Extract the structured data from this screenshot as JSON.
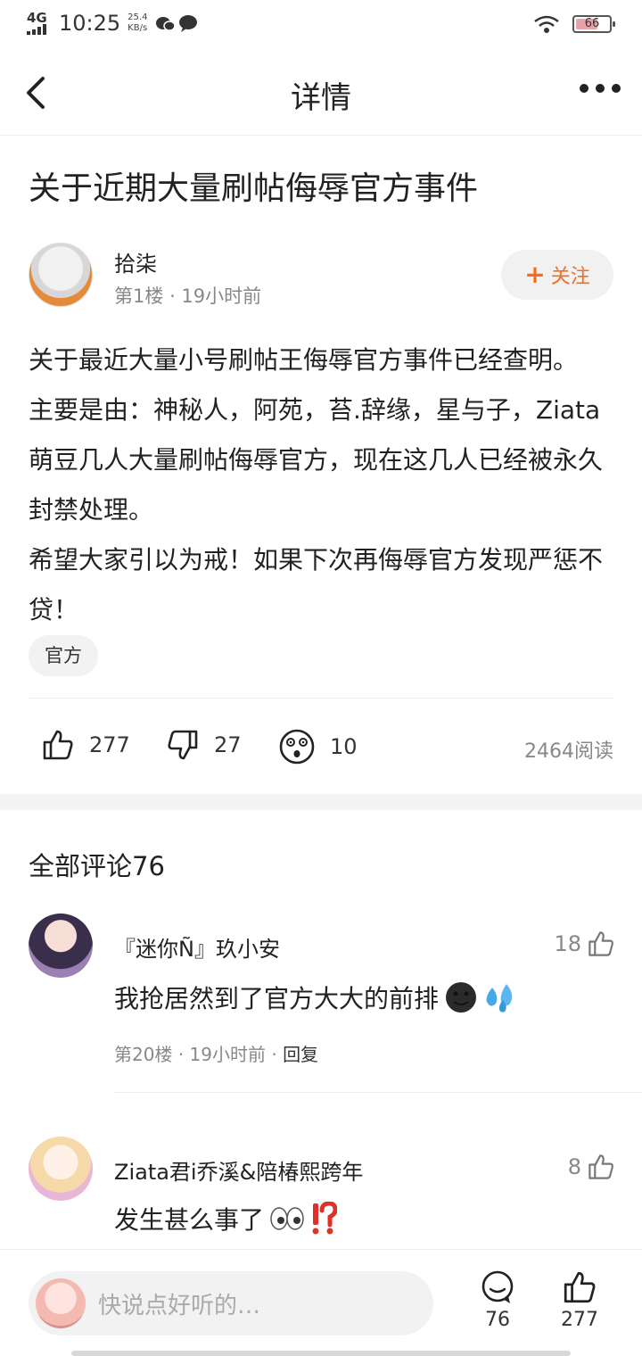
{
  "status_bar": {
    "network": "4G",
    "time": "10:25",
    "speed_value": "25.4",
    "speed_unit": "KB/s",
    "battery": "66"
  },
  "nav": {
    "title": "详情"
  },
  "post": {
    "title": "关于近期大量刷帖侮辱官方事件",
    "author": "拾柒",
    "floor": "第1楼",
    "time": "19小时前",
    "follow_label": "关注",
    "body": [
      "关于最近大量小号刷帖王侮辱官方事件已经查明。",
      "主要是由：神秘人，阿苑，苔.辞缘，星与子，Ziata萌豆几人大量刷帖侮辱官方，现在这几人已经被永久封禁处理。",
      "希望大家引以为戒！如果下次再侮辱官方发现严惩不贷！"
    ],
    "tag": "官方",
    "likes": "277",
    "dislikes": "27",
    "reactions": "10",
    "reads": "2464阅读"
  },
  "comments": {
    "header": "全部评论76",
    "items": [
      {
        "name": "『迷你Ñ』玖小安",
        "likes": "18",
        "text": "我抢居然到了官方大大的前排",
        "floor": "第20楼",
        "time": "19小时前",
        "reply": "回复"
      },
      {
        "name": "Ziata君i乔溪&陪椿熙跨年",
        "likes": "8",
        "text": "发生甚么事了"
      }
    ]
  },
  "bottom_bar": {
    "placeholder": "快说点好听的…",
    "comment_count": "76",
    "like_count": "277"
  },
  "colors": {
    "accent": "#f36f20",
    "divider": "#eeeeee",
    "muted": "#888888"
  }
}
